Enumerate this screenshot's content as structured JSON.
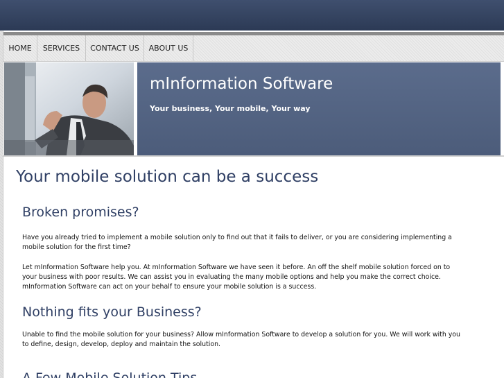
{
  "nav": {
    "items": [
      "HOME",
      "SERVICES",
      "CONTACT US",
      "ABOUT US"
    ]
  },
  "banner": {
    "title": "mInformation Software",
    "tagline": "Your business, Your mobile, Your way"
  },
  "content": {
    "main_heading": "Your mobile solution can be a success",
    "sections": [
      {
        "heading": "Broken promises?",
        "paragraphs": [
          "Have you already tried to implement a mobile solution only to find out that it fails to deliver, or you are considering implementing a mobile solution for the first time?",
          "Let mInformation Software help you.  At mInformation Software we have seen it before.  An off the shelf mobile solution forced on to your business with poor results.  We can assist you in evaluating the many mobile options and help you make the correct choice.  mInformation Software can act on your behalf to ensure your mobile solution is a success."
        ]
      },
      {
        "heading": "Nothing fits your Business?",
        "paragraphs": [
          "Unable to find the mobile solution for your business?  Allow mInformation Software to develop a solution for you.  We will work with you to define, design, develop, deploy and maintain the solution."
        ]
      },
      {
        "heading": "A Few Mobile Solution Tips",
        "paragraphs": []
      }
    ]
  },
  "colors": {
    "header_band": "#35445f",
    "banner_panel": "#55657f",
    "heading": "#2f3f64"
  }
}
